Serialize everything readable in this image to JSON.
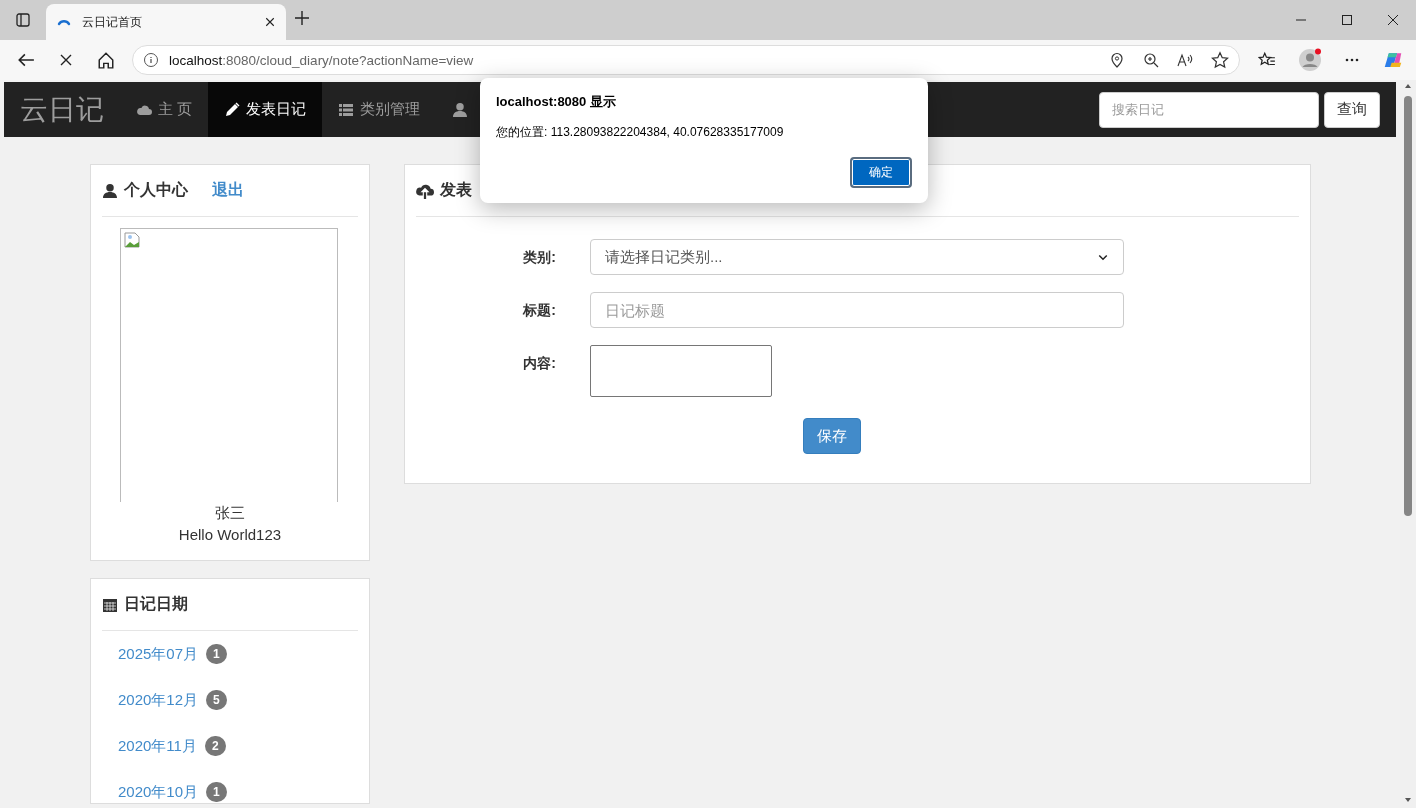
{
  "browser": {
    "tab_title": "云日记首页",
    "url_host": "localhost",
    "url_path": ":8080/cloud_diary/note?actionName=view"
  },
  "nav": {
    "brand": "云日记",
    "items": [
      {
        "label": "主 页",
        "selected": false
      },
      {
        "label": "发表日记",
        "selected": true
      },
      {
        "label": "类别管理",
        "selected": false
      },
      {
        "selected": false
      }
    ],
    "search": {
      "placeholder": "搜索日记"
    },
    "search_button": "查询"
  },
  "profile": {
    "title": "个人中心",
    "logout": "退出",
    "name": "张三",
    "motto": "Hello World123"
  },
  "dates": {
    "title": "日记日期",
    "items": [
      {
        "label": "2025年07月",
        "count": "1"
      },
      {
        "label": "2020年12月",
        "count": "5"
      },
      {
        "label": "2020年11月",
        "count": "2"
      },
      {
        "label": "2020年10月",
        "count": "1"
      }
    ]
  },
  "editor": {
    "title": "发表",
    "fields": [
      {
        "kind": "select",
        "label": "类别:",
        "value": "请选择日记类别..."
      },
      {
        "kind": "input",
        "label": "标题:",
        "placeholder": "日记标题"
      },
      {
        "kind": "textarea",
        "label": "内容:"
      }
    ],
    "save": "保存"
  },
  "alert": {
    "title": "localhost:8080 显示",
    "message": "您的位置: 113.28093822204384, 40.07628335177009",
    "ok": "确定"
  }
}
